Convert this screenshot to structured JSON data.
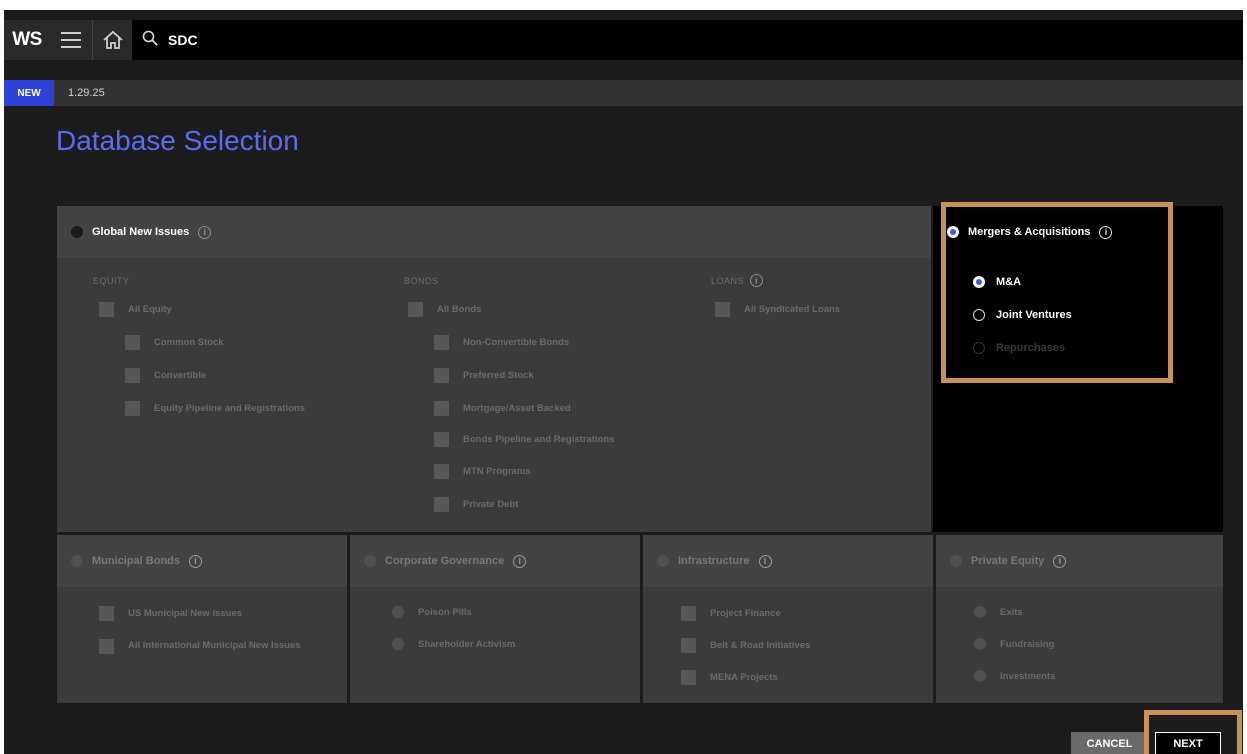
{
  "topbar": {
    "logo": "WS",
    "search_value": "SDC"
  },
  "subbar": {
    "badge": "NEW",
    "version": "1.29.25"
  },
  "title": "Database Selection",
  "global_new_issues": {
    "label": "Global New Issues",
    "equity": {
      "heading": "EQUITY",
      "items": [
        "All Equity",
        "Common Stock",
        "Convertible",
        "Equity Pipeline and Registrations"
      ]
    },
    "bonds": {
      "heading": "BONDS",
      "items": [
        "All Bonds",
        "Non-Convertible Bonds",
        "Preferred Stock",
        "Mortgage/Asset Backed",
        "Bonds Pipeline and Registrations",
        "MTN Programs",
        "Private Debt"
      ]
    },
    "loans": {
      "heading": "LOANS",
      "items": [
        "All Syndicated Loans"
      ]
    }
  },
  "mergers": {
    "label": "Mergers & Acquisitions",
    "options": [
      "M&A",
      "Joint Ventures",
      "Repurchases"
    ],
    "selected": "M&A"
  },
  "municipal_bonds": {
    "label": "Municipal Bonds",
    "items": [
      "US Municipal New Issues",
      "All International Municipal New Issues"
    ]
  },
  "corporate_governance": {
    "label": "Corporate Governance",
    "items": [
      "Poison Pills",
      "Shareholder Activism"
    ]
  },
  "infrastructure": {
    "label": "Infrastructure",
    "items": [
      "Project Finance",
      "Belt & Road Initiatives",
      "MENA Projects"
    ]
  },
  "private_equity": {
    "label": "Private Equity",
    "items": [
      "Exits",
      "Fundraising",
      "Investments"
    ]
  },
  "footer": {
    "cancel": "CANCEL",
    "next": "NEXT"
  },
  "colors": {
    "accent": "#5a6cf0",
    "highlight": "#c8915a",
    "badge": "#2d43d8"
  }
}
